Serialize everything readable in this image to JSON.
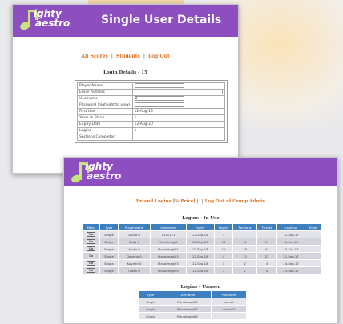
{
  "brand": {
    "line1": "ighty",
    "line2": "aestro"
  },
  "window1": {
    "title": "Single User Details",
    "nav": {
      "all_scores": "All Scores",
      "students": "Students",
      "logout": "Log Out"
    },
    "section_title": "Login Details - 15",
    "fields": [
      {
        "label": "Player Name",
        "value": ""
      },
      {
        "label": "Email Address",
        "value": ""
      },
      {
        "label": "Username",
        "value": "8"
      },
      {
        "label": "Password (highlight to view)",
        "value": ""
      },
      {
        "label": "First Use",
        "value": "12-Aug-19"
      },
      {
        "label": "Years In Place",
        "value": "1"
      },
      {
        "label": "Expiry Date",
        "value": "12-Aug-20"
      },
      {
        "label": "Logins",
        "value": "1"
      },
      {
        "label": "Sections Completed",
        "value": ""
      }
    ]
  },
  "window2": {
    "nav": {
      "extend": "Extend Logins [% Price]",
      "empty": "",
      "logout_group": "Log Out of Group Admin"
    },
    "in_use": {
      "title": "Logins - In Use",
      "columns": [
        "Mkey",
        "Type",
        "PlayerName",
        "Username",
        "Expiry",
        "Logins",
        "Sections",
        "Tickets",
        "LastUse",
        "Email"
      ],
      "rows": [
        {
          "btn": "Go",
          "type": "Single",
          "player": "Audio 0",
          "user": "1111111",
          "expiry": "12-Sep-18",
          "logins": "3",
          "sections": "",
          "tickets": "",
          "lastuse": "12-Sep-17",
          "email": ""
        },
        {
          "btn": "Go",
          "type": "Single",
          "player": "Addy 0",
          "user": "PianoImagi0",
          "expiry": "12-Sep-18",
          "logins": "11",
          "sections": "11",
          "tickets": "19",
          "lastuse": "11-Oct-17",
          "email": ""
        },
        {
          "btn": "Go",
          "type": "Single",
          "player": "Audio 0",
          "user": "PianoImagi01",
          "expiry": "12-Sep-18",
          "logins": "10",
          "sections": "18",
          "tickets": "47",
          "lastuse": "13-Oct-17",
          "email": ""
        },
        {
          "btn": "Go",
          "type": "Single",
          "player": "Daphne 0",
          "user": "PianoImagi02",
          "expiry": "12-Sep-18",
          "logins": "4",
          "sections": "12",
          "tickets": "23",
          "lastuse": "21-Sep-17",
          "email": ""
        },
        {
          "btn": "Go",
          "type": "Single",
          "player": "Kayden 0",
          "user": "PianoImagi03",
          "expiry": "12-Sep-18",
          "logins": "3",
          "sections": "2",
          "tickets": "4",
          "lastuse": "14-Sep-17",
          "email": ""
        },
        {
          "btn": "Go",
          "type": "Single",
          "player": "Owen 0",
          "user": "PianoImagi04",
          "expiry": "12-Sep-18",
          "logins": "3",
          "sections": "2",
          "tickets": "4",
          "lastuse": "23-Sep-17",
          "email": ""
        }
      ]
    },
    "unused": {
      "title": "Logins - Unused",
      "columns": [
        "Type",
        "Username",
        "Password"
      ],
      "rows": [
        {
          "type": "Single",
          "user": "PianoImagi06",
          "pass": "comet"
        },
        {
          "type": "Single",
          "user": "PianoImagi07",
          "pass": "dawn07"
        },
        {
          "type": "Single",
          "user": "PianoImagi08",
          "pass": ""
        }
      ]
    }
  }
}
